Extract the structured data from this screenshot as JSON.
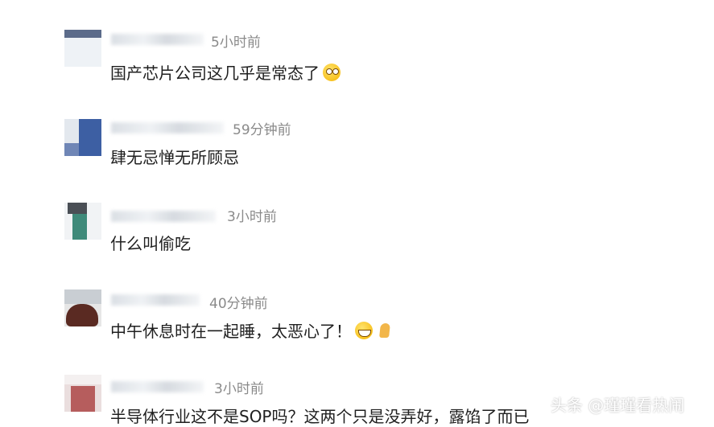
{
  "comments": [
    {
      "time": "5小时前",
      "text": "国产芯片公司这几乎是常态了",
      "emoji": "astonished-face-icon"
    },
    {
      "time": "59分钟前",
      "text": "肆无忌惮无所顾忌"
    },
    {
      "time": "3小时前",
      "text": "什么叫偷吃"
    },
    {
      "time": "40分钟前",
      "text": "中午休息时在一起睡，太恶心了！",
      "emoji": [
        "grinning-face-icon",
        "folded-hands-icon"
      ]
    },
    {
      "time": "3小时前",
      "text": "半导体行业这不是SOP吗？这两个只是没弄好，露馅了而已"
    }
  ],
  "watermark": "头条 @瑾瑾看热闹",
  "colors": {
    "text": "#1f1f1f",
    "time": "#8a8a8a",
    "background": "#ffffff"
  }
}
